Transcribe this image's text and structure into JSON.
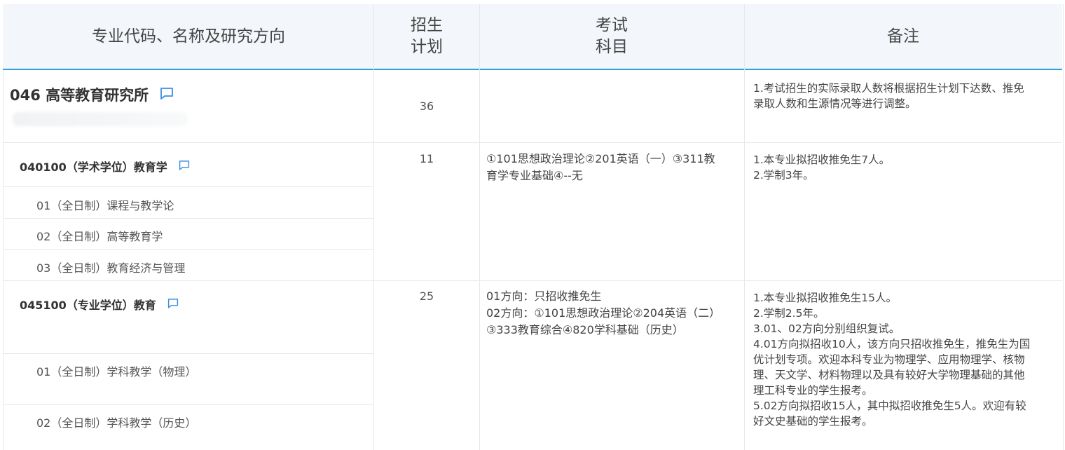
{
  "header": {
    "col1": "专业代码、名称及研究方向",
    "col2_line1": "招生",
    "col2_line2": "计划",
    "col3_line1": "考试",
    "col3_line2": "科目",
    "col4": "备注"
  },
  "department": {
    "name": "046 高等教育研究所",
    "plan": "36",
    "notes": [
      "1.考试招生的实际录取人数将根据招生计划下达数、推免",
      "录取人数和生源情况等进行调整。"
    ]
  },
  "majors": [
    {
      "name": "040100（学术学位）教育学",
      "plan": "11",
      "subjects": [
        "①101思想政治理论②201英语（一）③311教",
        "育学专业基础④--无"
      ],
      "directions": [
        "01（全日制）课程与教学论",
        "02（全日制）高等教育学",
        "03（全日制）教育经济与管理"
      ],
      "notes": [
        "1.本专业拟招收推免生7人。",
        "2.学制3年。"
      ]
    },
    {
      "name": "045100（专业学位）教育",
      "plan": "25",
      "subjects": [
        "01方向：只招收推免生",
        "02方向：①101思想政治理论②204英语（二）",
        "③333教育综合④820学科基础（历史）"
      ],
      "directions": [
        "01（全日制）学科教学（物理）",
        "02（全日制）学科教学（历史）"
      ],
      "notes": [
        "1.本专业拟招收推免生15人。",
        "2.学制2.5年。",
        "3.01、02方向分别组织复试。",
        "4.01方向拟招收10人，该方向只招收推免生，推免生为国",
        "优计划专项。欢迎本科专业为物理学、应用物理学、核物",
        "理、天文学、材料物理以及具有较好大学物理基础的其他",
        "理工科专业的学生报考。",
        "5.02方向拟招收15人，其中拟招收推免生5人。欢迎有较",
        "好文史基础的学生报考。"
      ]
    }
  ],
  "icons": {
    "comment": "comment-icon"
  },
  "colors": {
    "accent": "#29a3d9",
    "header_bg": "#f3f6fa",
    "icon": "#3d8fe0"
  }
}
